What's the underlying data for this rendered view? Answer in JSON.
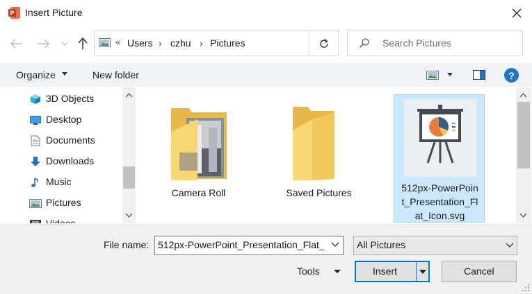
{
  "window": {
    "title": "Insert Picture",
    "icons": {
      "app": "powerpoint-icon",
      "close": "close-icon"
    }
  },
  "navigation": {
    "icons": {
      "back": "arrow-left-icon",
      "forward": "arrow-right-icon",
      "recent": "chevron-down-icon",
      "up": "arrow-up-icon"
    }
  },
  "address": {
    "overflow": "«",
    "breadcrumbs": [
      "Users",
      "czhu",
      "Pictures"
    ],
    "separator": "›",
    "icons": {
      "location": "pictures-folder-icon",
      "refresh": "refresh-icon"
    }
  },
  "search": {
    "placeholder": "Search Pictures",
    "icon": "search-icon"
  },
  "toolbar": {
    "organize": "Organize",
    "new_folder": "New folder",
    "help": "?",
    "icons": {
      "view": "view-icon",
      "preview_pane": "preview-pane-icon",
      "help": "help-icon"
    }
  },
  "sidebar": {
    "items": [
      {
        "label": "3D Objects",
        "icon": "3d-objects-icon"
      },
      {
        "label": "Desktop",
        "icon": "desktop-icon"
      },
      {
        "label": "Documents",
        "icon": "documents-icon"
      },
      {
        "label": "Downloads",
        "icon": "downloads-icon"
      },
      {
        "label": "Music",
        "icon": "music-icon"
      },
      {
        "label": "Pictures",
        "icon": "pictures-icon"
      },
      {
        "label": "Videos",
        "icon": "videos-icon"
      }
    ]
  },
  "files": [
    {
      "name": "Camera Roll",
      "icon": "folder-with-photos-icon",
      "selected": false
    },
    {
      "name": "Saved Pictures",
      "icon": "folder-icon",
      "selected": false
    },
    {
      "name": "512px-PowerPoint_Presentation_Flat_Icon.svg",
      "display_lines": [
        "512px-PowerPoin",
        "t_Presentation_Fl",
        "at_Icon.svg"
      ],
      "icon": "presentation-easel-icon",
      "selected": true
    }
  ],
  "footer": {
    "file_name_label": "File name:",
    "file_name_value": "512px-PowerPoint_Presentation_Flat_",
    "file_type_value": "All Pictures",
    "tools": "Tools",
    "insert": "Insert",
    "cancel": "Cancel"
  },
  "colors": {
    "accent": "#0078d7",
    "selection_bg": "#cce8ff",
    "selection_border": "#99d1ff",
    "toolbar_bg": "#f0f4f9",
    "footer_bg": "#f0f0f0",
    "folder": "#f8d775"
  }
}
